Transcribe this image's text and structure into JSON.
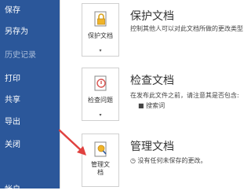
{
  "sidebar": {
    "items": [
      {
        "label": "保存",
        "disabled": false
      },
      {
        "label": "另存为",
        "disabled": false
      },
      {
        "label": "历史记录",
        "disabled": true
      },
      {
        "label": "打印",
        "disabled": false
      },
      {
        "label": "共享",
        "disabled": false
      },
      {
        "label": "导出",
        "disabled": false
      },
      {
        "label": "关闭",
        "disabled": false
      },
      {
        "label": "帐户",
        "disabled": false
      }
    ]
  },
  "sections": {
    "protect": {
      "tile_label": "保护文档",
      "title": "保护文档",
      "desc": "控制其他人可以对此文档所做的更改类型"
    },
    "inspect": {
      "tile_label": "检查问题",
      "title": "检查文档",
      "desc": "在发布此文件之前，请注意其是否包含:",
      "bullet": "搜索词"
    },
    "manage": {
      "tile_label_line1": "管理文",
      "tile_label_line2": "档",
      "title": "管理文档",
      "desc": "没有任何未保存的更改。"
    }
  },
  "colors": {
    "sidebar": "#2b579a",
    "arrow": "#e0413f"
  }
}
